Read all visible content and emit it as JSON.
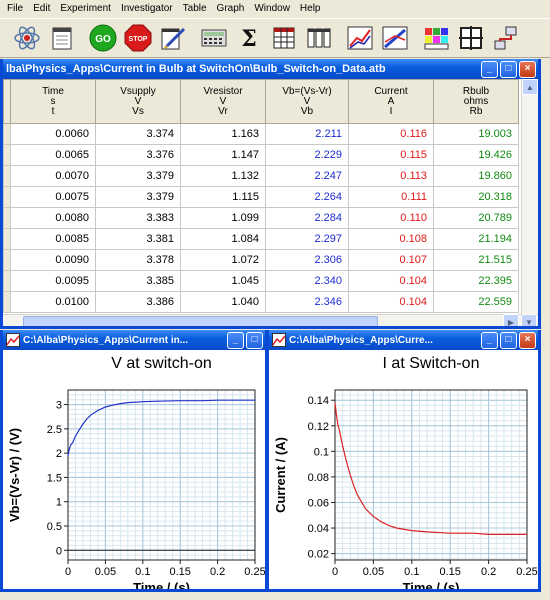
{
  "menu": [
    "File",
    "Edit",
    "Experiment",
    "Investigator",
    "Table",
    "Graph",
    "Window",
    "Help"
  ],
  "toolbar_icons": [
    "atom-icon",
    "notepad-icon",
    "go-button-icon",
    "stop-button-icon",
    "notes-pen-icon",
    "calculator-icon",
    "sigma-icon",
    "table-icon",
    "bar-table-icon",
    "line-graph-icon",
    "dual-graph-icon",
    "color-grid-icon",
    "crosshair-icon",
    "network-icon"
  ],
  "toolbar_go": "GO",
  "toolbar_stop": "STOP",
  "toolbar_sigma": "Σ",
  "table_window": {
    "title": "lba\\Physics_Apps\\Current in Bulb at SwitchOn\\Bulb_Switch-on_Data.atb",
    "columns": [
      {
        "l1": "Time",
        "l2": "s",
        "l3": "t"
      },
      {
        "l1": "Vsupply",
        "l2": "V",
        "l3": "Vs"
      },
      {
        "l1": "Vresistor",
        "l2": "V",
        "l3": "Vr"
      },
      {
        "l1": "Vb=(Vs-Vr)",
        "l2": "V",
        "l3": "Vb"
      },
      {
        "l1": "Current",
        "l2": "A",
        "l3": "I"
      },
      {
        "l1": "Rbulb",
        "l2": "ohms",
        "l3": "Rb"
      }
    ],
    "rows": [
      [
        "0.0060",
        "3.374",
        "1.163",
        "2.211",
        "0.116",
        "19.003"
      ],
      [
        "0.0065",
        "3.376",
        "1.147",
        "2.229",
        "0.115",
        "19.426"
      ],
      [
        "0.0070",
        "3.379",
        "1.132",
        "2.247",
        "0.113",
        "19.860"
      ],
      [
        "0.0075",
        "3.379",
        "1.115",
        "2.264",
        "0.111",
        "20.318"
      ],
      [
        "0.0080",
        "3.383",
        "1.099",
        "2.284",
        "0.110",
        "20.789"
      ],
      [
        "0.0085",
        "3.381",
        "1.084",
        "2.297",
        "0.108",
        "21.194"
      ],
      [
        "0.0090",
        "3.378",
        "1.072",
        "2.306",
        "0.107",
        "21.515"
      ],
      [
        "0.0095",
        "3.385",
        "1.045",
        "2.340",
        "0.104",
        "22.395"
      ],
      [
        "0.0100",
        "3.386",
        "1.040",
        "2.346",
        "0.104",
        "22.559"
      ]
    ]
  },
  "graph_windows": [
    {
      "title": "C:\\Alba\\Physics_Apps\\Current in..."
    },
    {
      "title": "C:\\Alba\\Physics_Apps\\Curre..."
    }
  ],
  "chart_data": [
    {
      "type": "line",
      "title": "V at switch-on",
      "xlabel": "Time / (s)",
      "ylabel": "Vb=(Vs-Vr) / (V)",
      "xlim": [
        0,
        0.25
      ],
      "ylim": [
        -0.2,
        3.3
      ],
      "xticks": [
        0,
        0.05,
        0.1,
        0.15,
        0.2,
        0.25
      ],
      "xtick_labels": [
        "0",
        "0.05",
        "0.1",
        "0.15",
        "0.2",
        "0.25"
      ],
      "yticks": [
        0,
        0.5,
        1,
        1.5,
        2,
        2.5,
        3
      ],
      "ytick_labels": [
        "0",
        "0.5",
        "1",
        "1.5",
        "2",
        "2.5",
        "3"
      ],
      "grid": true,
      "color": "#2233cc",
      "x": [
        0.0,
        0.002,
        0.004,
        0.006,
        0.008,
        0.01,
        0.015,
        0.02,
        0.025,
        0.03,
        0.04,
        0.05,
        0.06,
        0.07,
        0.08,
        0.1,
        0.12,
        0.15,
        0.18,
        0.2,
        0.22,
        0.25
      ],
      "y": [
        1.95,
        2.1,
        2.18,
        2.21,
        2.28,
        2.35,
        2.48,
        2.6,
        2.7,
        2.78,
        2.88,
        2.95,
        2.99,
        3.02,
        3.04,
        3.06,
        3.07,
        3.08,
        3.08,
        3.09,
        3.09,
        3.09
      ]
    },
    {
      "type": "line",
      "title": "I at Switch-on",
      "xlabel": "Time / (s)",
      "ylabel": "Current / (A)",
      "xlim": [
        0,
        0.25
      ],
      "ylim": [
        0.015,
        0.148
      ],
      "xticks": [
        0,
        0.05,
        0.1,
        0.15,
        0.2,
        0.25
      ],
      "xtick_labels": [
        "0",
        "0.05",
        "0.1",
        "0.15",
        "0.2",
        "0.25"
      ],
      "yticks": [
        0.02,
        0.04,
        0.06,
        0.08,
        0.1,
        0.12,
        0.14
      ],
      "ytick_labels": [
        "0.02",
        "0.04",
        "0.06",
        "0.08",
        "0.1",
        "0.12",
        "0.14"
      ],
      "grid": true,
      "color": "#dd2222",
      "x": [
        0.0,
        0.002,
        0.004,
        0.006,
        0.008,
        0.01,
        0.015,
        0.02,
        0.025,
        0.03,
        0.04,
        0.05,
        0.06,
        0.07,
        0.08,
        0.1,
        0.12,
        0.15,
        0.18,
        0.2,
        0.22,
        0.25
      ],
      "y": [
        0.138,
        0.128,
        0.12,
        0.116,
        0.11,
        0.104,
        0.092,
        0.081,
        0.072,
        0.065,
        0.055,
        0.049,
        0.045,
        0.042,
        0.04,
        0.038,
        0.037,
        0.036,
        0.036,
        0.035,
        0.035,
        0.035
      ]
    }
  ]
}
